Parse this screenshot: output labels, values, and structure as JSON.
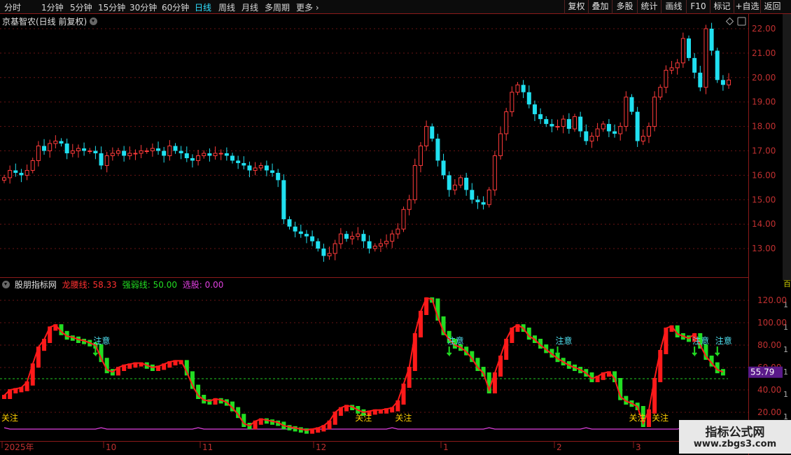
{
  "toolbar": {
    "timeframes": [
      "分时",
      "1分钟",
      "5分钟",
      "15分钟",
      "30分钟",
      "60分钟",
      "日线",
      "周线",
      "月线",
      "多周期"
    ],
    "active_timeframe": "日线",
    "more": "更多",
    "right_buttons": [
      "复权",
      "叠加",
      "多股",
      "统计",
      "画线",
      "F10",
      "标记",
      "+自选",
      "返回"
    ]
  },
  "stock": {
    "title": "京基智农(日线 前复权)"
  },
  "price_axis": {
    "ticks": [
      "22.00",
      "21.00",
      "20.00",
      "19.00",
      "18.00",
      "17.00",
      "16.00",
      "15.00",
      "14.00",
      "13.00"
    ]
  },
  "indicator": {
    "name": "股朋指标网",
    "line1_label": "龙腰线:",
    "line1_value": "58.33",
    "line2_label": "强弱线:",
    "line2_value": "50.00",
    "line3_label": "选股:",
    "line3_value": "0.00",
    "axis_ticks": [
      "120.00",
      "100.00",
      "80.00",
      "60.00",
      "40.00",
      "20.00"
    ],
    "current_value": "55.79",
    "guide_level": 50,
    "signals": {
      "notice": "注意",
      "focus": "关注"
    }
  },
  "date_axis": {
    "labels": [
      "2025年",
      "10",
      "11",
      "12",
      "1",
      "2",
      "3"
    ]
  },
  "side_fragments": [
    "百",
    "1",
    "1",
    "1",
    "1",
    "1",
    "1"
  ],
  "watermark": {
    "line1": "指标公式网",
    "line2": "www.zbgs3.com"
  },
  "colors": {
    "up": "#ff3b3b",
    "down": "#20e0f0",
    "ind_up": "#ff1a1a",
    "ind_down": "#22dd22",
    "guide": "#22cc22",
    "pink": "#e040e0",
    "notice": "#50e0f0",
    "focus": "#ffd000",
    "badge": "#5a1a8a"
  },
  "chart_data": [
    {
      "type": "candlestick",
      "title": "京基智农(日线 前复权)",
      "ylim": [
        12.4,
        22.3
      ],
      "close": [
        15.9,
        16.2,
        16.1,
        16.0,
        16.2,
        16.6,
        17.2,
        17.0,
        17.3,
        17.4,
        17.3,
        16.9,
        17.0,
        17.1,
        17.0,
        17.0,
        16.9,
        16.4,
        16.8,
        16.9,
        17.0,
        16.8,
        16.9,
        16.9,
        17.0,
        17.0,
        17.1,
        17.0,
        16.8,
        17.2,
        17.0,
        16.9,
        16.7,
        16.6,
        16.8,
        16.9,
        16.8,
        16.9,
        16.9,
        16.8,
        16.6,
        16.5,
        16.4,
        16.2,
        16.3,
        16.4,
        16.2,
        16.1,
        15.8,
        14.2,
        13.9,
        13.7,
        13.6,
        13.5,
        13.3,
        13.0,
        12.7,
        12.8,
        13.2,
        13.6,
        13.4,
        13.5,
        13.6,
        13.3,
        13.0,
        13.1,
        13.2,
        13.3,
        13.6,
        13.8,
        14.6,
        15.0,
        16.4,
        17.2,
        18.0,
        17.5,
        16.6,
        16.0,
        15.4,
        15.6,
        15.9,
        15.4,
        15.0,
        14.9,
        14.8,
        15.4,
        16.8,
        17.7,
        18.6,
        19.4,
        19.7,
        19.4,
        18.9,
        18.5,
        18.3,
        18.1,
        18.0,
        18.0,
        18.3,
        17.9,
        18.4,
        17.8,
        17.4,
        17.6,
        17.9,
        18.1,
        17.8,
        17.7,
        18.0,
        19.2,
        18.6,
        17.4,
        17.6,
        18.0,
        19.2,
        19.6,
        20.3,
        20.4,
        20.6,
        21.6,
        20.8,
        20.2,
        19.6,
        22.0,
        21.1,
        19.9,
        19.7,
        19.9
      ],
      "series_colors": {
        "up": "#ff3b3b",
        "down": "#20e0f0"
      }
    },
    {
      "type": "bar-line",
      "title": "股朋指标网",
      "ylim": [
        0,
        128
      ],
      "values": [
        35,
        40,
        41,
        42,
        47,
        63,
        78,
        85,
        96,
        98,
        92,
        88,
        87,
        85,
        84,
        82,
        80,
        68,
        58,
        56,
        60,
        62,
        63,
        64,
        64,
        62,
        60,
        61,
        63,
        65,
        66,
        66,
        56,
        44,
        35,
        31,
        30,
        32,
        31,
        29,
        24,
        18,
        10,
        8,
        12,
        14,
        13,
        12,
        11,
        8,
        7,
        6,
        5,
        4,
        5,
        6,
        8,
        12,
        20,
        24,
        26,
        25,
        22,
        20,
        21,
        22,
        22,
        23,
        24,
        30,
        45,
        60,
        90,
        110,
        122,
        121,
        105,
        92,
        85,
        80,
        78,
        74,
        68,
        60,
        55,
        40,
        55,
        70,
        85,
        95,
        98,
        95,
        88,
        85,
        80,
        76,
        72,
        68,
        65,
        62,
        60,
        58,
        55,
        50,
        52,
        55,
        56,
        50,
        34,
        30,
        28,
        25,
        10,
        22,
        50,
        75,
        95,
        97,
        90,
        88,
        86,
        90,
        80,
        70,
        64,
        58,
        56
      ]
    }
  ]
}
